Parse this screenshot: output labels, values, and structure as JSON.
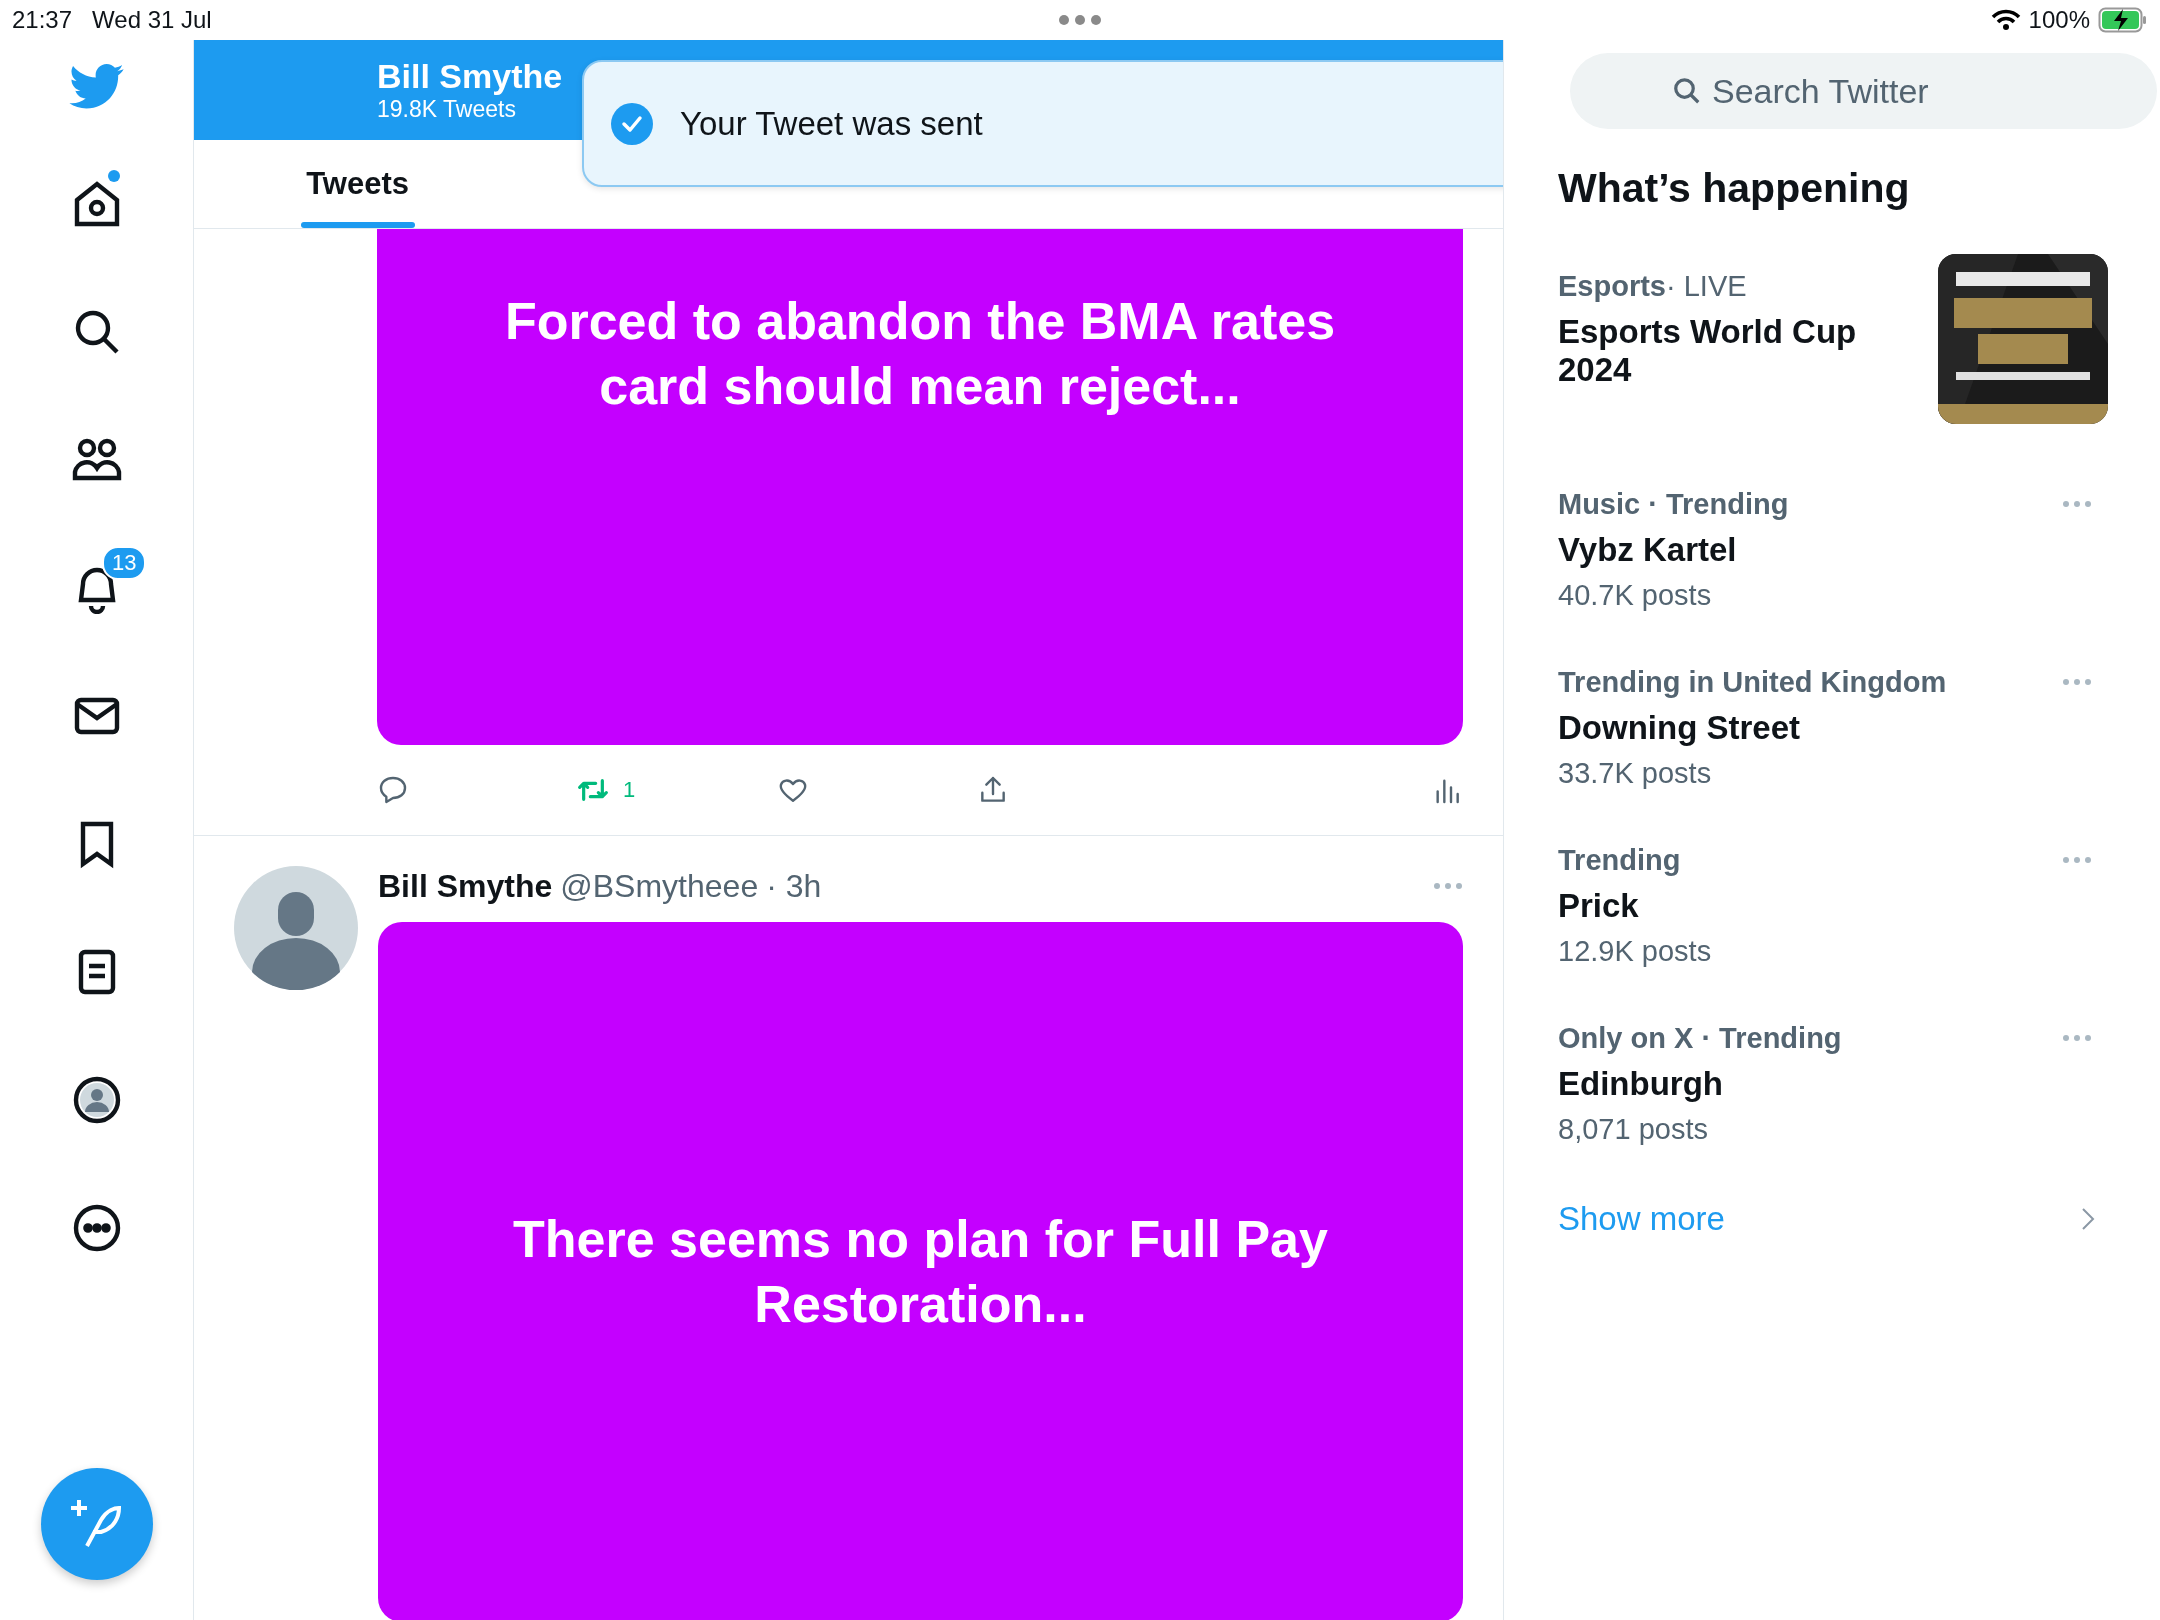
{
  "status_bar": {
    "time": "21:37",
    "date": "Wed 31 Jul",
    "battery": "100%",
    "charging": true
  },
  "nav": [
    {
      "kind": "home",
      "dot": true
    },
    {
      "kind": "search",
      "dot": false
    },
    {
      "kind": "communities",
      "dot": false
    },
    {
      "kind": "notifications",
      "dot": false,
      "badge": "13"
    },
    {
      "kind": "messages",
      "dot": false
    },
    {
      "kind": "bookmarks",
      "dot": false
    },
    {
      "kind": "lists",
      "dot": false
    },
    {
      "kind": "profile",
      "dot": false
    },
    {
      "kind": "more",
      "dot": false
    }
  ],
  "profile_header": {
    "name": "Bill Smythe",
    "count": "19.8K Tweets"
  },
  "tabs": [
    {
      "label": "Tweets",
      "selected": true
    }
  ],
  "toast": {
    "text": "Your Tweet was sent"
  },
  "tweets": [
    {
      "media_text": "Forced to abandon the BMA rates card should mean reject...",
      "actions": [
        {
          "kind": "reply",
          "active": false
        },
        {
          "kind": "retweet",
          "active": true,
          "count": "1"
        },
        {
          "kind": "like",
          "active": false
        },
        {
          "kind": "share",
          "active": false
        },
        {
          "kind": "stats",
          "active": false
        }
      ]
    },
    {
      "author": "Bill Smythe",
      "handle": "@BSmytheee",
      "time": "· 3h",
      "media_text": "There seems no plan for Full Pay Restoration..."
    }
  ],
  "search": {
    "placeholder": "Search Twitter"
  },
  "trends_title": "What’s happening",
  "trends": [
    {
      "kind": "event",
      "category": "Esports",
      "context": "· LIVE",
      "title": "Esports World Cup 2024"
    },
    {
      "kind": "trend",
      "category": "Music · Trending",
      "title": "Vybz Kartel",
      "posts": "40.7K posts"
    },
    {
      "kind": "trend",
      "category": "Trending in United Kingdom",
      "title": "Downing Street",
      "posts": "33.7K posts"
    },
    {
      "kind": "trend",
      "category": "Trending",
      "title": "Prick",
      "posts": "12.9K posts"
    },
    {
      "kind": "trend",
      "category": "Only on X · Trending",
      "title": "Edinburgh",
      "posts": "8,071 posts"
    }
  ],
  "show_more": "Show more"
}
